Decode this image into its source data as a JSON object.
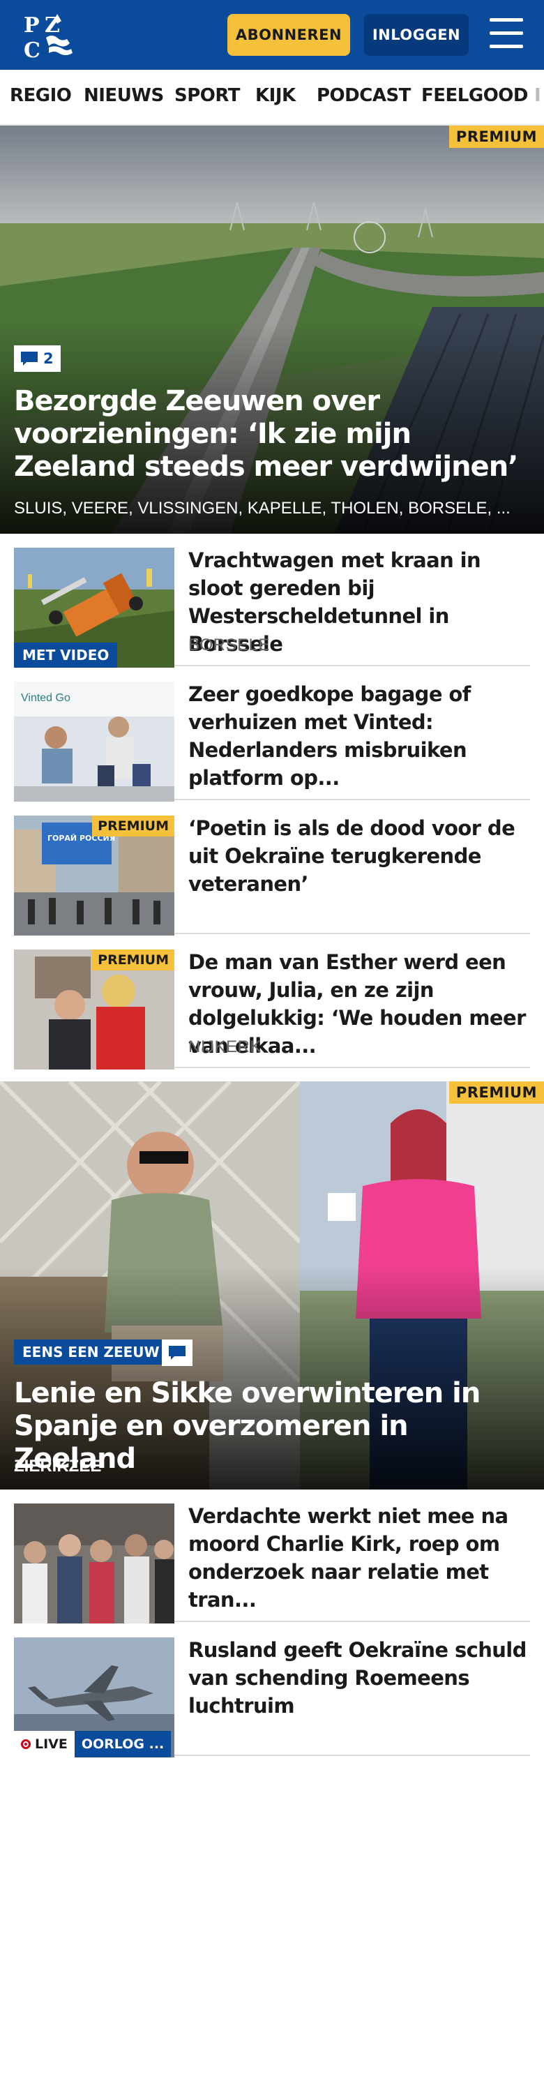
{
  "header": {
    "logo_text": "PZC",
    "subscribe_label": "ABONNEREN",
    "login_label": "INLOGGEN",
    "menu_icon": "hamburger-menu-icon",
    "bg_color": "#0a4b9c",
    "accent_color": "#f5c13a"
  },
  "nav": {
    "items": [
      "REGIO",
      "NIEUWS",
      "SPORT",
      "KIJK",
      "PODCAST",
      "FEELGOOD",
      "I"
    ]
  },
  "hero": {
    "premium_label": "PREMIUM",
    "comment_count": "2",
    "title": "Bezorgde Zeeuwen over voorzienin­gen: ‘Ik zie mijn Zeeland steeds meer verdwijnen’",
    "locations": "SLUIS, VEERE, VLISSINGEN, KAPELLE, THOLEN, BORSELE, ..."
  },
  "articles": [
    {
      "title": "Vrachtwagen met kraan in sloot gereden bij Westerscheldetunnel in Borssele",
      "location": "BORSELE",
      "badge": "MET VIDEO"
    },
    {
      "title": "Zeer goedkope bagage of verhuizen met Vinted: Nederlan­ders misbruiken platform op...",
      "thumb_text": "Vinted Go"
    },
    {
      "title": "‘Poetin is als de dood voor de uit Oekraïne terugkerende veteranen’",
      "premium_label": "PREMIUM",
      "thumb_text": "ГОРАЙ РОССИЯ"
    },
    {
      "title": "De man van Esther werd een vrouw, Julia, en ze zijn dolgeluk­kig: ‘We houden meer van elkaa...",
      "location": "NIJKERK",
      "premium_label": "PREMIUM"
    }
  ],
  "hero2": {
    "premium_label": "PREMIUM",
    "tag": "EENS EEN ZEEUW",
    "title": "Lenie en Sikke overwinteren in Spanje en overzomeren in Zeeland",
    "location": "ZIERIKZEE"
  },
  "articles2": [
    {
      "title": "Verdachte werkt niet mee na moord Charlie Kirk, roep om onderzoek naar relatie met tran..."
    },
    {
      "title": "Rusland geeft Oekraïne schuld van schending Roemeens luchtruim",
      "live_label": "LIVE",
      "category": "OORLOG ..."
    }
  ]
}
